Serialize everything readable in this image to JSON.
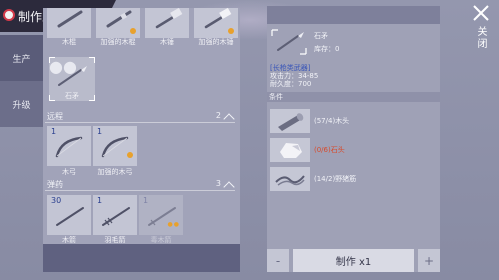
{
  "header": {
    "title": "制作工作台"
  },
  "tabs": [
    {
      "label": "生产"
    },
    {
      "label": "升级"
    }
  ],
  "top_items": [
    {
      "label": "木棍"
    },
    {
      "label": "加强的木棍"
    },
    {
      "label": "木锤"
    },
    {
      "label": "加强的木锤"
    }
  ],
  "selected_item": {
    "label": "石矛"
  },
  "sections": {
    "ranged": {
      "name": "远程",
      "count": "2"
    },
    "ammo": {
      "name": "弹药",
      "count": "3"
    }
  },
  "ranged_items": [
    {
      "count": "1",
      "label": "木弓"
    },
    {
      "count": "1",
      "label": "加强的木弓"
    }
  ],
  "ammo_items": [
    {
      "count": "30",
      "label": "木箭"
    },
    {
      "count": "1",
      "label": "羽毛箭"
    },
    {
      "count": "1",
      "label": "毒木箭"
    }
  ],
  "detail": {
    "name": "石矛",
    "stock": "库存：0",
    "category": "[长枪类武器]",
    "attack": "攻击力：34-85",
    "durability": "耐久度：700"
  },
  "conditions": {
    "header": "条件",
    "items": [
      {
        "label": "(57/4)木头"
      },
      {
        "label": "(0/6)石头"
      },
      {
        "label": "(14/2)野猪筋"
      }
    ]
  },
  "craft": {
    "minus": "-",
    "label": "制作 x1",
    "plus": "+"
  },
  "close": {
    "label": "关闭"
  },
  "colors": {
    "insufficient": "#d74b2c",
    "category": "#3a56b8",
    "rare_dot": "#e8a12c"
  }
}
